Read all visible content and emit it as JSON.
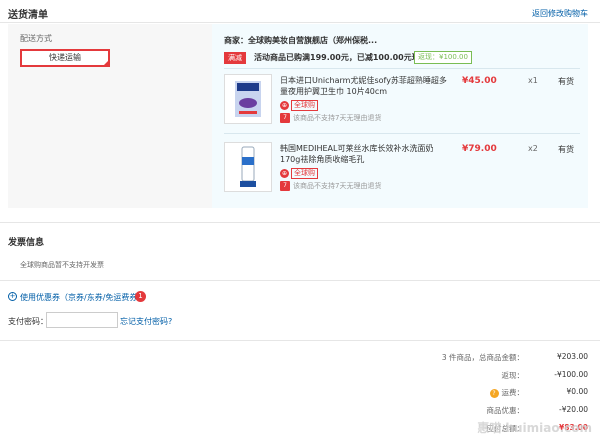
{
  "header": {
    "title": "送货清单",
    "back_link": "返回修改购物车"
  },
  "shipping": {
    "label": "配送方式",
    "option": "快递运输"
  },
  "store": {
    "name": "商家：全球购美妆自营旗舰店（郑州保税...",
    "close": "×",
    "promo_badge": "满减",
    "promo_text": "活动商品已购满199.00元，已减100.00元现金",
    "promo_paid": "返现：¥100.00"
  },
  "products": [
    {
      "name": "日本进口Unicharm尤妮佳sofy苏菲超熟睡超多量夜用护翼卫生巾 10片40cm",
      "global_tag": "全球购",
      "return_note": "该商品不支持7天无理由退货",
      "seven_badge": "7",
      "price": "¥45.00",
      "qty": "x1",
      "stock": "有货"
    },
    {
      "name": "韩国MEDIHEAL可莱丝水库长效补水洗面奶170g祛除角质收缩毛孔",
      "global_tag": "全球购",
      "return_note": "该商品不支持7天无理由退货",
      "seven_badge": "7",
      "price": "¥79.00",
      "qty": "x2",
      "stock": "有货"
    }
  ],
  "invoice": {
    "title": "发票信息",
    "text": "全球购商品暂不支持开发票"
  },
  "coupon": {
    "icon": "+",
    "link": "使用优惠券（京券/东券/免运费券）",
    "count": "1"
  },
  "payment": {
    "label": "支付密码：",
    "value": "",
    "forgot": "忘记支付密码?"
  },
  "summary": [
    {
      "label": "3 件商品，总商品金额：",
      "value": "¥203.00"
    },
    {
      "label": "返现：",
      "value": "-¥100.00"
    },
    {
      "label": "运费：",
      "value": "¥0.00",
      "help": "?"
    },
    {
      "label": "商品优惠：",
      "value": "-¥20.00"
    },
    {
      "label": "应付总额：",
      "value": "¥83.00"
    }
  ],
  "watermark": "惠喵 huimiao.com",
  "colors": {
    "accent": "#e4393c",
    "link": "#005ea7",
    "green": "#7abd54"
  }
}
